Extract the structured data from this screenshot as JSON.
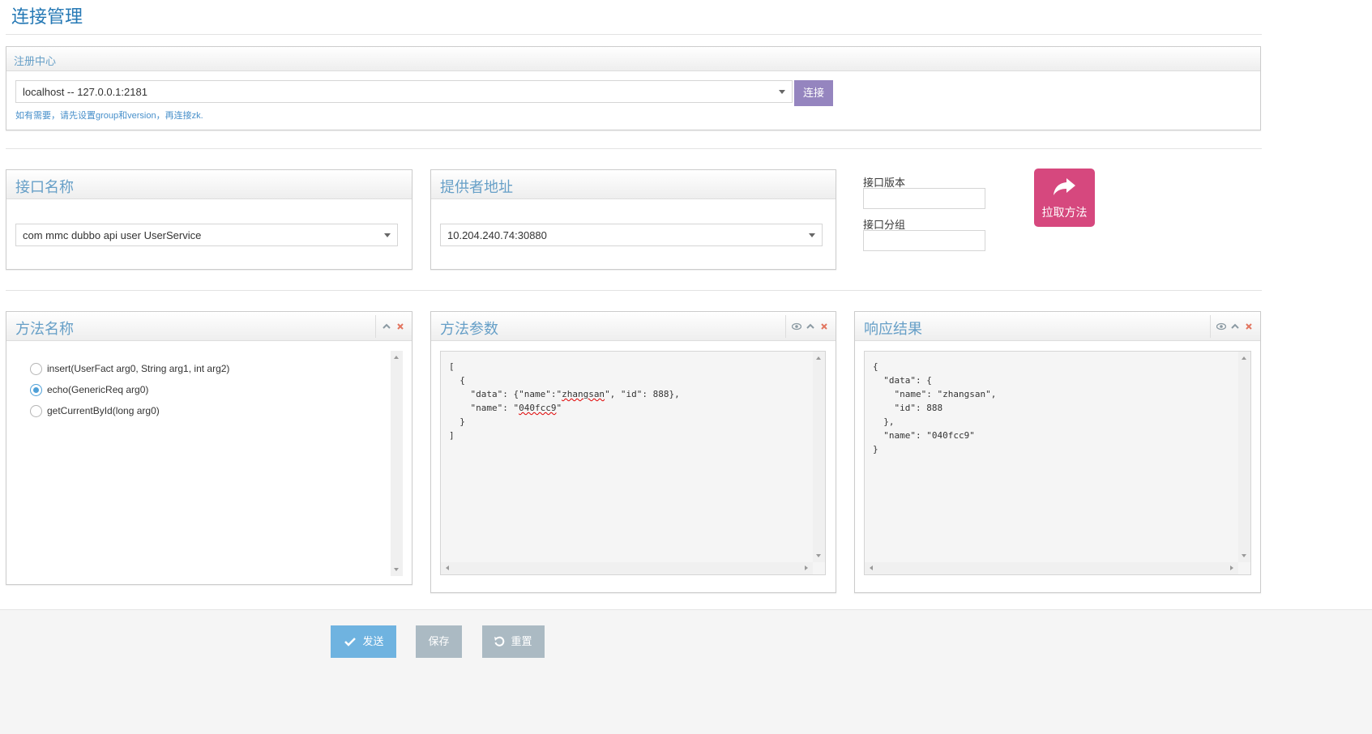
{
  "page": {
    "title": "连接管理"
  },
  "registry": {
    "title": "注册中心",
    "selected": "localhost -- 127.0.0.1:2181",
    "connect_label": "连接",
    "hint": "如有需要，请先设置group和version，再连接zk."
  },
  "interface_box": {
    "title": "接口名称",
    "selected": "com mmc dubbo api user UserService"
  },
  "provider_box": {
    "title": "提供者地址",
    "selected": "10.204.240.74:30880"
  },
  "version": {
    "label": "接口版本",
    "value": ""
  },
  "group": {
    "label": "接口分组",
    "value": ""
  },
  "pull_button": {
    "label": "拉取方法",
    "icon": "share-arrow-icon"
  },
  "methods_box": {
    "title": "方法名称",
    "items": [
      {
        "label": "insert(UserFact arg0, String arg1, int arg2)",
        "checked": false
      },
      {
        "label": "echo(GenericReq arg0)",
        "checked": true
      },
      {
        "label": "getCurrentById(long arg0)",
        "checked": false
      }
    ]
  },
  "params_box": {
    "title": "方法参数",
    "line1": "[",
    "line2": "  {",
    "line3a": "    \"data\": {\"name\":\"",
    "line3b": "zhangsan",
    "line3c": "\", \"id\": 888},",
    "line4a": "    \"name\": \"",
    "line4b": "040fcc9",
    "line4c": "\"",
    "line5": "  }",
    "line6": "]"
  },
  "result_box": {
    "title": "响应结果",
    "content": "{\n  \"data\": {\n    \"name\": \"zhangsan\",\n    \"id\": 888\n  },\n  \"name\": \"040fcc9\"\n}"
  },
  "footer": {
    "send_label": "发送",
    "save_label": "保存",
    "reset_label": "重置"
  },
  "colors": {
    "title_blue": "#2679b5",
    "header_blue": "#669fc7",
    "connect_purple": "#9585bf",
    "pull_pink": "#d6487e",
    "send_blue": "#6fb3e0",
    "gray_button": "#abbac3"
  }
}
